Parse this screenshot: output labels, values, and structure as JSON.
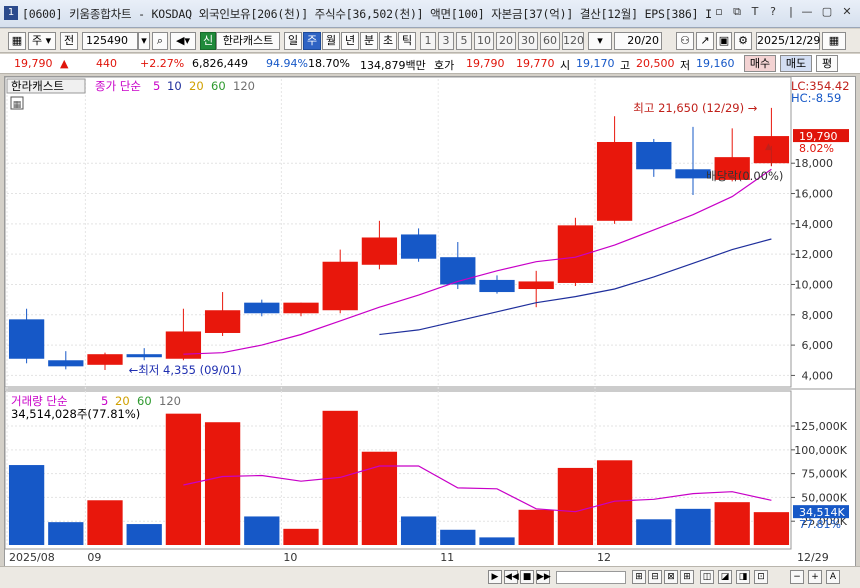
{
  "window": {
    "num": "1",
    "title": "[0600] 키움종합차트 - KOSDAQ 외국인보유[206(천)] 주식수[36,502(천)] 액면[100] 자본금[37(억)] 결산[12월] EPS[386] I",
    "buttons": [
      "▫",
      "⧉",
      "T",
      "?",
      "|",
      "—",
      "▢",
      "✕"
    ]
  },
  "toolbar": {
    "period_sel": "주",
    "prev_label": "전",
    "code": "125490",
    "stock_badge": "신",
    "stock_name": "한라캐스트",
    "tabs": [
      "일",
      "주",
      "월",
      "년",
      "분",
      "초",
      "틱"
    ],
    "selected_tab": "주",
    "intervals": [
      "1",
      "3",
      "5",
      "10",
      "20",
      "30",
      "60",
      "120"
    ],
    "count": "20",
    "count_total": "/20",
    "date": "2025/12/29"
  },
  "quote": {
    "price": "19,790",
    "arrow": "▲",
    "change": "440",
    "rate": "+2.27%",
    "volume": "6,826,449",
    "vol_ratio": "94.94%",
    "turnover": "18.70%",
    "amount": "134,879백만",
    "ask_label": "호가",
    "ask1": "19,790",
    "ask2": "19,770",
    "open_label": "시",
    "open": "19,170",
    "high_label": "고",
    "high": "20,500",
    "low_label": "저",
    "low": "19,160",
    "buy_btn": "매수",
    "sell_btn": "매도",
    "eval_btn": "평"
  },
  "chart_data": {
    "type": "candlestick",
    "stock_tag": "한라캐스트",
    "legend_label": "종가 단순",
    "ma_periods": [
      "5",
      "10",
      "20",
      "60",
      "120"
    ],
    "ma_colors": [
      "#c800c8",
      "#1f2f9c",
      "#d0a000",
      "#2e9a2e",
      "#707070"
    ],
    "lc_label": "LC:354.42",
    "hc_label": "HC:-8.59",
    "current_price_tag": "19,790",
    "current_rate_tag": "8.02%",
    "price_ylim": [
      3500,
      22500
    ],
    "price_ticks": [
      "4,000",
      "6,000",
      "8,000",
      "10,000",
      "12,000",
      "14,000",
      "16,000",
      "18,000"
    ],
    "price_tick_values": [
      4000,
      6000,
      8000,
      10000,
      12000,
      14000,
      16000,
      18000
    ],
    "candles": [
      {
        "o": 7700,
        "h": 8400,
        "l": 4800,
        "c": 5100
      },
      {
        "o": 5000,
        "h": 5600,
        "l": 4400,
        "c": 4600
      },
      {
        "o": 4700,
        "h": 5500,
        "l": 4355,
        "c": 5400
      },
      {
        "o": 5400,
        "h": 5800,
        "l": 5000,
        "c": 5200
      },
      {
        "o": 5100,
        "h": 8400,
        "l": 5000,
        "c": 6900
      },
      {
        "o": 6800,
        "h": 9500,
        "l": 6600,
        "c": 8300
      },
      {
        "o": 8800,
        "h": 9000,
        "l": 7900,
        "c": 8100
      },
      {
        "o": 8100,
        "h": 8800,
        "l": 7900,
        "c": 8800
      },
      {
        "o": 8300,
        "h": 12300,
        "l": 8100,
        "c": 11500
      },
      {
        "o": 11300,
        "h": 14200,
        "l": 11000,
        "c": 13100
      },
      {
        "o": 13300,
        "h": 13700,
        "l": 11500,
        "c": 11700
      },
      {
        "o": 11800,
        "h": 12800,
        "l": 9700,
        "c": 10000
      },
      {
        "o": 10300,
        "h": 10600,
        "l": 9400,
        "c": 9500
      },
      {
        "o": 9700,
        "h": 10900,
        "l": 8500,
        "c": 10200
      },
      {
        "o": 10100,
        "h": 14400,
        "l": 9900,
        "c": 13900
      },
      {
        "o": 14200,
        "h": 21100,
        "l": 14000,
        "c": 19400
      },
      {
        "o": 19400,
        "h": 19600,
        "l": 17100,
        "c": 17600
      },
      {
        "o": 17600,
        "h": 20400,
        "l": 15900,
        "c": 17000
      },
      {
        "o": 16900,
        "h": 20300,
        "l": 16800,
        "c": 18400
      },
      {
        "o": 18000,
        "h": 21650,
        "l": 17800,
        "c": 19790
      }
    ],
    "ma5": [
      null,
      null,
      null,
      null,
      5400,
      5500,
      6000,
      6700,
      7600,
      8500,
      9300,
      10200,
      10900,
      11500,
      11800,
      12600,
      13600,
      14600,
      15800,
      17600
    ],
    "ma10": [
      null,
      null,
      null,
      null,
      null,
      null,
      null,
      null,
      null,
      6700,
      7000,
      7600,
      8200,
      8800,
      9200,
      9700,
      10500,
      11400,
      12300,
      13000
    ],
    "annotations": [
      {
        "text": "최저 4,355 (09/01)",
        "idx": 2,
        "value": 4355,
        "dir": "left"
      },
      {
        "text": "최고 21,650 (12/29)",
        "idx": 19,
        "value": 21650,
        "dir": "right"
      },
      {
        "text": "배당락(0.00%)",
        "idx": 19,
        "value": 17300,
        "dir": "up"
      }
    ],
    "volume": {
      "label": "거래량 단순",
      "ma_periods": [
        "5",
        "20",
        "60",
        "120"
      ],
      "current": "34,514,028주(77.81%)",
      "ylim": [
        0,
        145000
      ],
      "ticks": [
        "25,000K",
        "50,000K",
        "75,000K",
        "100,000K",
        "125,000K"
      ],
      "tick_values": [
        25000,
        50000,
        75000,
        100000,
        125000
      ],
      "tag_value": "34,514K",
      "tag_rate": "77.81%",
      "values": [
        84000,
        24000,
        47000,
        22000,
        138000,
        129000,
        30000,
        17000,
        141000,
        98000,
        30000,
        16000,
        8000,
        37000,
        81000,
        89000,
        27000,
        38000,
        45000,
        34514
      ],
      "ma5": [
        null,
        null,
        null,
        null,
        63000,
        72000,
        73000,
        67000,
        71000,
        83000,
        83000,
        60000,
        59000,
        38000,
        35000,
        46000,
        48000,
        54000,
        56000,
        47000
      ]
    },
    "x_labels": [
      {
        "text": "2025/08",
        "idx": 0
      },
      {
        "text": "09",
        "idx": 2
      },
      {
        "text": "10",
        "idx": 7
      },
      {
        "text": "11",
        "idx": 11
      },
      {
        "text": "12",
        "idx": 15
      }
    ],
    "x_end_label": "12/29",
    "up_color": "#e8170c",
    "down_color": "#1658c7"
  },
  "bottom": {
    "buttons": [
      "▶",
      "◀◀",
      "■",
      "▶▶",
      "⊞",
      "⊟",
      "⊠",
      "⊞",
      "◫",
      "◪",
      "◨",
      "⊡",
      "−",
      "+",
      "A"
    ]
  }
}
